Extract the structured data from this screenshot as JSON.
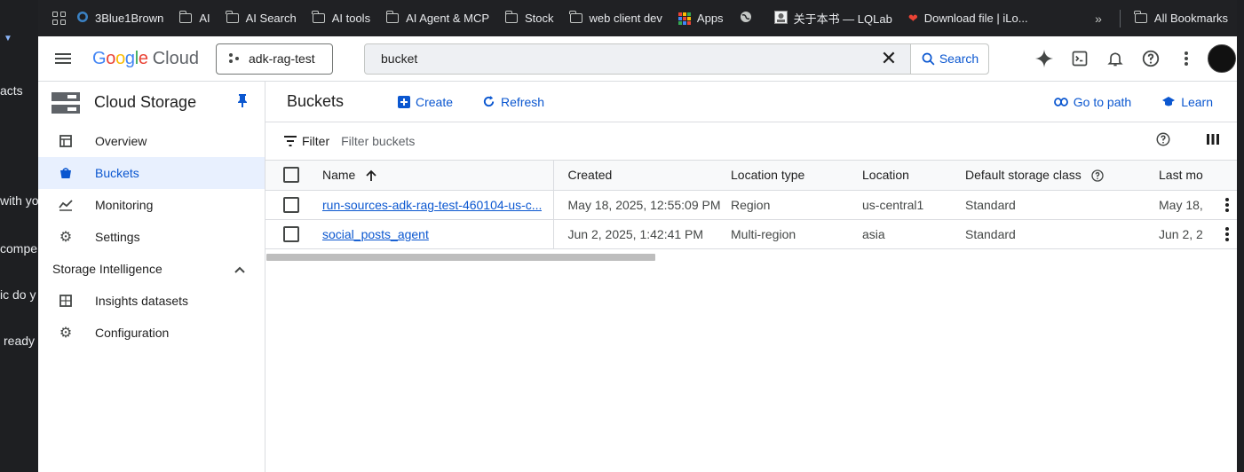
{
  "left_fragments": [
    "acts",
    "with yo",
    "compe",
    "ic do y",
    "ready"
  ],
  "bookmarks": {
    "items": [
      {
        "label": "3Blue1Brown",
        "icon": "3blue1brown-icon"
      },
      {
        "label": "AI",
        "icon": "folder-icon"
      },
      {
        "label": "AI Search",
        "icon": "folder-icon"
      },
      {
        "label": "AI tools",
        "icon": "folder-icon"
      },
      {
        "label": "AI Agent & MCP",
        "icon": "folder-icon"
      },
      {
        "label": "Stock",
        "icon": "folder-icon"
      },
      {
        "label": "web client dev",
        "icon": "folder-icon"
      },
      {
        "label": "Apps",
        "icon": "apps-grid-icon"
      },
      {
        "label": "",
        "icon": "globe-icon"
      },
      {
        "label": "关于本书 — LQLab",
        "icon": "lqlab-icon"
      },
      {
        "label": "Download file | iLo...",
        "icon": "heart-icon"
      }
    ],
    "overflow": "»",
    "all_bookmarks": "All Bookmarks"
  },
  "header": {
    "logo_google": "Google",
    "logo_cloud": "Cloud",
    "project": "adk-rag-test",
    "search_value": "bucket",
    "search_button": "Search"
  },
  "sidebar": {
    "title": "Cloud Storage",
    "items": [
      {
        "label": "Overview",
        "icon": "overview-icon"
      },
      {
        "label": "Buckets",
        "icon": "bucket-icon",
        "active": true
      },
      {
        "label": "Monitoring",
        "icon": "monitoring-icon"
      },
      {
        "label": "Settings",
        "icon": "settings-icon"
      }
    ],
    "section": "Storage Intelligence",
    "section_items": [
      {
        "label": "Insights datasets",
        "icon": "insights-icon"
      },
      {
        "label": "Configuration",
        "icon": "configuration-icon"
      }
    ]
  },
  "main": {
    "title": "Buckets",
    "create": "Create",
    "refresh": "Refresh",
    "go_to_path": "Go to path",
    "learn": "Learn",
    "filter_label": "Filter",
    "filter_placeholder": "Filter buckets"
  },
  "table": {
    "columns": [
      "Name",
      "Created",
      "Location type",
      "Location",
      "Default storage class",
      "Last mo"
    ],
    "rows": [
      {
        "name": "run-sources-adk-rag-test-460104-us-c...",
        "created": "May 18, 2025, 12:55:09 PM",
        "location_type": "Region",
        "location": "us-central1",
        "storage_class": "Standard",
        "last": "May 18,"
      },
      {
        "name": "social_posts_agent",
        "created": "Jun 2, 2025, 1:42:41 PM",
        "location_type": "Multi-region",
        "location": "asia",
        "storage_class": "Standard",
        "last": "Jun 2, 2"
      }
    ]
  },
  "colors": {
    "accent": "#0b57d0",
    "active_bg": "#e8f0fe",
    "bookmark_bar": "#202124"
  }
}
